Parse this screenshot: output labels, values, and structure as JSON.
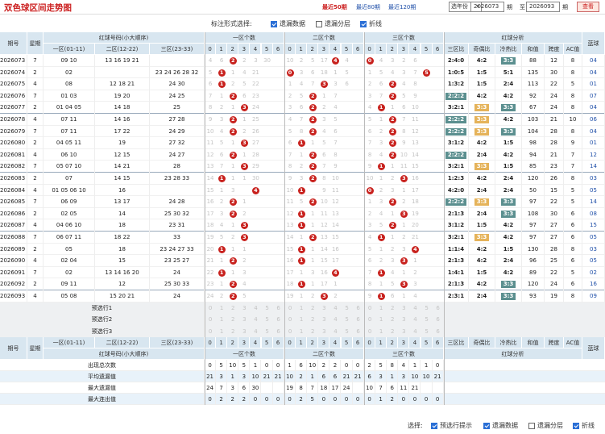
{
  "header": {
    "title": "双色球区间走势图",
    "links": [
      "最近50期",
      "最近80期",
      "最近120期"
    ],
    "active_link": 0,
    "year_select": "选年份",
    "from_issue": "2026073",
    "to_issue": "2026093",
    "label_qi": "期",
    "label_zhi": "至",
    "query": "查看"
  },
  "options": {
    "label": "标注形式选择:",
    "items": [
      {
        "label": "遗漏数据",
        "checked": true
      },
      {
        "label": "遗漏分层",
        "checked": false
      },
      {
        "label": "折线",
        "checked": true
      }
    ]
  },
  "table": {
    "headers": {
      "qihao": "期号",
      "week": "星期",
      "red_group": "红球号码(小大顺序)",
      "zone1": "一区(01-11)",
      "zone2": "二区(12-22)",
      "zone3": "三区(23-33)",
      "cnt1": "一区个数",
      "cnt2": "二区个数",
      "cnt3": "三区个数",
      "analysis": "红球分析",
      "zone_ratio": "三区比",
      "odd_even": "奇偶比",
      "hot_cold": "冷热比",
      "sum": "和值",
      "span": "跨度",
      "ac": "AC值",
      "blue": "蓝球"
    },
    "digits": [
      "0",
      "1",
      "2",
      "3",
      "4",
      "5",
      "6"
    ],
    "rows": [
      {
        "q": "2026073",
        "w": "7",
        "z1": "09 10",
        "z2": "13 16 19 21",
        "z3": "",
        "c1": 2,
        "c2": 4,
        "c3": 0,
        "ratio": "2:4:0",
        "oe": "4:2",
        "hc": "3:3",
        "sum": "88",
        "span": "12",
        "ac": "8",
        "blue": "04",
        "m1": [
          "4",
          "6",
          "",
          "2",
          "3",
          "30",
          ""
        ],
        "m2": [
          "10",
          "2",
          "5",
          "17",
          "",
          "4",
          ""
        ],
        "m3": [
          "",
          "4",
          "3",
          "2",
          "6",
          "",
          ""
        ]
      },
      {
        "q": "2026074",
        "w": "2",
        "z1": "02",
        "z2": "",
        "z3": "23 24 26 28 32",
        "c1": 1,
        "c2": 0,
        "c3": 5,
        "ratio": "1:0:5",
        "oe": "1:5",
        "hc": "5:1",
        "sum": "135",
        "span": "30",
        "ac": "8",
        "blue": "04",
        "m1": [
          "5",
          "",
          "1",
          "4",
          "21",
          "",
          ""
        ],
        "m2": [
          "",
          "3",
          "6",
          "18",
          "1",
          "5",
          ""
        ],
        "m3": [
          "1",
          "5",
          "4",
          "3",
          "7",
          "",
          ""
        ]
      },
      {
        "q": "2026075",
        "w": "4",
        "z1": "08",
        "z2": "12 18 21",
        "z3": "24 30",
        "c1": 1,
        "c2": 3,
        "c3": 2,
        "ratio": "1:3:2",
        "oe": "1:5",
        "hc": "2:4",
        "sum": "113",
        "span": "22",
        "ac": "5",
        "blue": "01",
        "m1": [
          "6",
          "",
          "2",
          "5",
          "22",
          "",
          ""
        ],
        "m2": [
          "1",
          "4",
          "7",
          "",
          "3",
          "6",
          ""
        ],
        "m3": [
          "2",
          "6",
          "",
          "4",
          "8",
          "",
          ""
        ]
      },
      {
        "q": "2026076",
        "w": "7",
        "z1": "01 03",
        "z2": "19 20",
        "z3": "24 25",
        "c1": 2,
        "c2": 2,
        "c3": 2,
        "ratio": "2:2:2",
        "oe": "4:2",
        "hc": "4:2",
        "sum": "92",
        "span": "24",
        "ac": "8",
        "blue": "07",
        "m1": [
          "7",
          "1",
          "",
          "6",
          "23",
          "",
          ""
        ],
        "m2": [
          "2",
          "5",
          "",
          "1",
          "7",
          "",
          ""
        ],
        "m3": [
          "3",
          "7",
          "",
          "5",
          "9",
          "",
          ""
        ]
      },
      {
        "q": "2026077",
        "w": "2",
        "z1": "01 04 05",
        "z2": "14 18",
        "z3": "25",
        "c1": 3,
        "c2": 2,
        "c3": 1,
        "ratio": "3:2:1",
        "oe": "3:3",
        "hc": "3:3",
        "sum": "67",
        "span": "24",
        "ac": "8",
        "blue": "04",
        "m1": [
          "8",
          "2",
          "1",
          "",
          "24",
          "",
          ""
        ],
        "m2": [
          "3",
          "6",
          "",
          "2",
          "4",
          "",
          ""
        ],
        "m3": [
          "4",
          "",
          "1",
          "6",
          "10",
          "",
          ""
        ]
      },
      {
        "q": "2026078",
        "w": "4",
        "z1": "07 11",
        "z2": "14 16",
        "z3": "27 28",
        "c1": 2,
        "c2": 2,
        "c3": 2,
        "ratio": "2:2:2",
        "oe": "3:3",
        "hc": "4:2",
        "sum": "103",
        "span": "21",
        "ac": "10",
        "blue": "06",
        "m1": [
          "9",
          "3",
          "",
          "1",
          "25",
          "",
          ""
        ],
        "m2": [
          "4",
          "7",
          "",
          "3",
          "5",
          "",
          ""
        ],
        "m3": [
          "5",
          "1",
          "",
          "7",
          "11",
          "",
          ""
        ]
      },
      {
        "q": "2026079",
        "w": "7",
        "z1": "07 11",
        "z2": "17 22",
        "z3": "24 29",
        "c1": 2,
        "c2": 2,
        "c3": 2,
        "ratio": "2:2:2",
        "oe": "3:3",
        "hc": "3:3",
        "sum": "104",
        "span": "28",
        "ac": "8",
        "blue": "04",
        "m1": [
          "10",
          "4",
          "",
          "2",
          "26",
          "",
          ""
        ],
        "m2": [
          "5",
          "8",
          "",
          "4",
          "6",
          "",
          ""
        ],
        "m3": [
          "6",
          "2",
          "",
          "8",
          "12",
          "",
          ""
        ]
      },
      {
        "q": "2026080",
        "w": "2",
        "z1": "04 05 11",
        "z2": "19",
        "z3": "27 32",
        "c1": 3,
        "c2": 1,
        "c3": 2,
        "ratio": "3:1:2",
        "oe": "4:2",
        "hc": "1:5",
        "sum": "98",
        "span": "28",
        "ac": "9",
        "blue": "01",
        "m1": [
          "11",
          "5",
          "1",
          "",
          "27",
          "",
          ""
        ],
        "m2": [
          "6",
          "",
          "1",
          "5",
          "7",
          "",
          ""
        ],
        "m3": [
          "7",
          "3",
          "",
          "9",
          "13",
          "",
          ""
        ]
      },
      {
        "q": "2026081",
        "w": "4",
        "z1": "06 10",
        "z2": "12 15",
        "z3": "24 27",
        "c1": 2,
        "c2": 2,
        "c3": 2,
        "ratio": "2:2:2",
        "oe": "2:4",
        "hc": "4:2",
        "sum": "94",
        "span": "21",
        "ac": "7",
        "blue": "12",
        "m1": [
          "12",
          "6",
          "",
          "1",
          "28",
          "",
          ""
        ],
        "m2": [
          "7",
          "1",
          "",
          "6",
          "8",
          "",
          ""
        ],
        "m3": [
          "8",
          "4",
          "",
          "10",
          "14",
          "",
          ""
        ]
      },
      {
        "q": "2026082",
        "w": "7",
        "z1": "05 07 10",
        "z2": "14 21",
        "z3": "28",
        "c1": 3,
        "c2": 2,
        "c3": 1,
        "ratio": "3:2:1",
        "oe": "3:3",
        "hc": "1:5",
        "sum": "85",
        "span": "23",
        "ac": "7",
        "blue": "14",
        "m1": [
          "13",
          "7",
          "1",
          "",
          "29",
          "",
          ""
        ],
        "m2": [
          "8",
          "2",
          "",
          "7",
          "9",
          "",
          ""
        ],
        "m3": [
          "9",
          "",
          "1",
          "11",
          "15",
          "",
          ""
        ]
      },
      {
        "q": "2026083",
        "w": "2",
        "z1": "07",
        "z2": "14 15",
        "z3": "23 28 33",
        "c1": 1,
        "c2": 2,
        "c3": 3,
        "ratio": "1:2:3",
        "oe": "4:2",
        "hc": "2:4",
        "sum": "120",
        "span": "26",
        "ac": "8",
        "blue": "03",
        "m1": [
          "14",
          "",
          "1",
          "1",
          "30",
          "",
          ""
        ],
        "m2": [
          "9",
          "3",
          "",
          "8",
          "10",
          "",
          ""
        ],
        "m3": [
          "10",
          "1",
          "2",
          "",
          "16",
          "",
          ""
        ]
      },
      {
        "q": "2026084",
        "w": "4",
        "z1": "01 05 06 10",
        "z2": "16",
        "z3": "",
        "c1": 4,
        "c2": 1,
        "c3": 0,
        "ratio": "4:2:0",
        "oe": "2:4",
        "hc": "2:4",
        "sum": "50",
        "span": "15",
        "ac": "5",
        "blue": "05",
        "m1": [
          "15",
          "1",
          "3",
          "",
          "",
          "",
          " "
        ],
        "m2": [
          "10",
          "4",
          "",
          "9",
          "11",
          "",
          ""
        ],
        "m3": [
          "",
          "2",
          "3",
          "1",
          "17",
          "",
          ""
        ]
      },
      {
        "q": "2026085",
        "w": "7",
        "z1": "06 09",
        "z2": "13 17",
        "z3": "24 28",
        "c1": 2,
        "c2": 2,
        "c3": 2,
        "ratio": "2:2:2",
        "oe": "3:3",
        "hc": "3:3",
        "sum": "97",
        "span": "22",
        "ac": "5",
        "blue": "14",
        "m1": [
          "16",
          "2",
          "",
          "1",
          "",
          "",
          ""
        ],
        "m2": [
          "11",
          "5",
          "",
          "10",
          "12",
          "",
          ""
        ],
        "m3": [
          "1",
          "3",
          "",
          "2",
          "18",
          "",
          ""
        ]
      },
      {
        "q": "2026086",
        "w": "2",
        "z1": "02 05",
        "z2": "14",
        "z3": "25 30 32",
        "c1": 2,
        "c2": 1,
        "c3": 3,
        "ratio": "2:1:3",
        "oe": "2:4",
        "hc": "3:3",
        "sum": "108",
        "span": "30",
        "ac": "6",
        "blue": "08",
        "m1": [
          "17",
          "3",
          "",
          "2",
          "",
          "",
          ""
        ],
        "m2": [
          "12",
          "",
          "1",
          "11",
          "13",
          "",
          ""
        ],
        "m3": [
          "2",
          "4",
          "1",
          "",
          "19",
          "",
          ""
        ]
      },
      {
        "q": "2026087",
        "w": "4",
        "z1": "04 06 10",
        "z2": "18",
        "z3": "23 31",
        "c1": 3,
        "c2": 1,
        "c3": 2,
        "ratio": "3:1:2",
        "oe": "1:5",
        "hc": "4:2",
        "sum": "97",
        "span": "27",
        "ac": "6",
        "blue": "15",
        "m1": [
          "18",
          "4",
          "1",
          "",
          "",
          "",
          ""
        ],
        "m2": [
          "13",
          "",
          "1",
          "12",
          "14",
          "",
          ""
        ],
        "m3": [
          "3",
          "5",
          "",
          "1",
          "20",
          "",
          ""
        ]
      },
      {
        "q": "2026088",
        "w": "7",
        "z1": "06 07 11",
        "z2": "18 22",
        "z3": "33",
        "c1": 3,
        "c2": 2,
        "c3": 1,
        "ratio": "3:2:1",
        "oe": "3:3",
        "hc": "4:2",
        "sum": "97",
        "span": "27",
        "ac": "6",
        "blue": "05",
        "m1": [
          "19",
          "5",
          "2",
          "",
          "",
          "",
          ""
        ],
        "m2": [
          "14",
          "1",
          "",
          "13",
          "15",
          "",
          ""
        ],
        "m3": [
          "4",
          "",
          "1",
          "2",
          "21",
          "",
          ""
        ]
      },
      {
        "q": "2026089",
        "w": "2",
        "z1": "05",
        "z2": "18",
        "z3": "23 24 27 33",
        "c1": 1,
        "c2": 1,
        "c3": 4,
        "ratio": "1:1:4",
        "oe": "4:2",
        "hc": "1:5",
        "sum": "130",
        "span": "28",
        "ac": "8",
        "blue": "03",
        "m1": [
          "20",
          "",
          "1",
          "1",
          "",
          "",
          ""
        ],
        "m2": [
          "15",
          "",
          "1",
          "14",
          "16",
          "",
          ""
        ],
        "m3": [
          "5",
          "1",
          "2",
          "3",
          "",
          "",
          ""
        ]
      },
      {
        "q": "2026090",
        "w": "4",
        "z1": "02 04",
        "z2": "15",
        "z3": "23 25 27",
        "c1": 2,
        "c2": 1,
        "c3": 3,
        "ratio": "2:1:3",
        "oe": "4:2",
        "hc": "2:4",
        "sum": "96",
        "span": "25",
        "ac": "6",
        "blue": "05",
        "m1": [
          "21",
          "1",
          "",
          "2",
          "",
          "",
          ""
        ],
        "m2": [
          "16",
          "",
          "1",
          "15",
          "17",
          "",
          ""
        ],
        "m3": [
          "6",
          "2",
          "3",
          "",
          "1",
          "",
          ""
        ]
      },
      {
        "q": "2026091",
        "w": "7",
        "z1": "02",
        "z2": "13 14 16 20",
        "z3": "24",
        "c1": 1,
        "c2": 4,
        "c3": 1,
        "ratio": "1:4:1",
        "oe": "1:5",
        "hc": "4:2",
        "sum": "89",
        "span": "22",
        "ac": "5",
        "blue": "02",
        "m1": [
          "22",
          "",
          "1",
          "3",
          "",
          "",
          ""
        ],
        "m2": [
          "17",
          "1",
          "3",
          "16",
          "",
          "",
          ""
        ],
        "m3": [
          "7",
          "",
          "4",
          "1",
          "2",
          "",
          ""
        ]
      },
      {
        "q": "2026092",
        "w": "2",
        "z1": "09 11",
        "z2": "12",
        "z3": "25 30 33",
        "c1": 2,
        "c2": 1,
        "c3": 3,
        "ratio": "2:1:3",
        "oe": "4:2",
        "hc": "3:3",
        "sum": "120",
        "span": "24",
        "ac": "6",
        "blue": "16",
        "m1": [
          "23",
          "1",
          "",
          "4",
          "",
          "",
          ""
        ],
        "m2": [
          "18",
          "",
          "1",
          "17",
          "1",
          "",
          ""
        ],
        "m3": [
          "8",
          "1",
          "5",
          "",
          "3",
          "",
          ""
        ]
      },
      {
        "q": "2026093",
        "w": "4",
        "z1": "05 08",
        "z2": "15 20 21",
        "z3": "24",
        "c1": 2,
        "c2": 3,
        "c3": 1,
        "ratio": "2:3:1",
        "oe": "2:4",
        "hc": "3:3",
        "sum": "93",
        "span": "19",
        "ac": "8",
        "blue": "09",
        "m1": [
          "24",
          "2",
          "",
          "5",
          "",
          "",
          ""
        ],
        "m2": [
          "19",
          "1",
          "2",
          "",
          "2",
          "",
          ""
        ],
        "m3": [
          "9",
          "",
          "6",
          "1",
          "4",
          "",
          ""
        ]
      }
    ],
    "preselect": [
      "预选行1",
      "预选行2",
      "预选行3"
    ],
    "footer_label": "红球号码(小大顺序)",
    "stats": [
      {
        "label": "出现总次数",
        "v1": [
          "0",
          "5",
          "10",
          "5",
          "1",
          "0",
          "0"
        ],
        "v2": [
          "1",
          "6",
          "10",
          "2",
          "2",
          "0",
          "0"
        ],
        "v3": [
          "2",
          "5",
          "8",
          "4",
          "1",
          "1",
          "0"
        ]
      },
      {
        "label": "平均遗漏值",
        "v1": [
          "21",
          "3",
          "1",
          "3",
          "10",
          "21",
          "21"
        ],
        "v2": [
          "10",
          "2",
          "1",
          "6",
          "6",
          "21",
          "21"
        ],
        "v3": [
          "6",
          "3",
          "1",
          "3",
          "10",
          "10",
          "21"
        ]
      },
      {
        "label": "最大遗漏值",
        "v1": [
          "24",
          "7",
          "3",
          "6",
          "30",
          "",
          ""
        ],
        "v2": [
          "19",
          "8",
          "7",
          "18",
          "17",
          "24",
          ""
        ],
        "v3": [
          "10",
          "7",
          "6",
          "11",
          "21",
          "",
          ""
        ]
      },
      {
        "label": "最大连出值",
        "v1": [
          "0",
          "2",
          "2",
          "2",
          "0",
          "0",
          "0"
        ],
        "v2": [
          "0",
          "2",
          "5",
          "0",
          "0",
          "0",
          "0"
        ],
        "v3": [
          "0",
          "1",
          "2",
          "0",
          "0",
          "0",
          "0"
        ]
      }
    ]
  },
  "bottom": {
    "label": "选择:",
    "items": [
      {
        "label": "预选行提示",
        "checked": true
      },
      {
        "label": "遗漏数据",
        "checked": true
      },
      {
        "label": "遗漏分层",
        "checked": false
      },
      {
        "label": "折线",
        "checked": true
      }
    ]
  },
  "colors": {
    "accent": "#c8211d",
    "header_bg": "#d8e6f0",
    "ratio_green": "#5b8f8f",
    "ratio_orange": "#e5b35a"
  }
}
